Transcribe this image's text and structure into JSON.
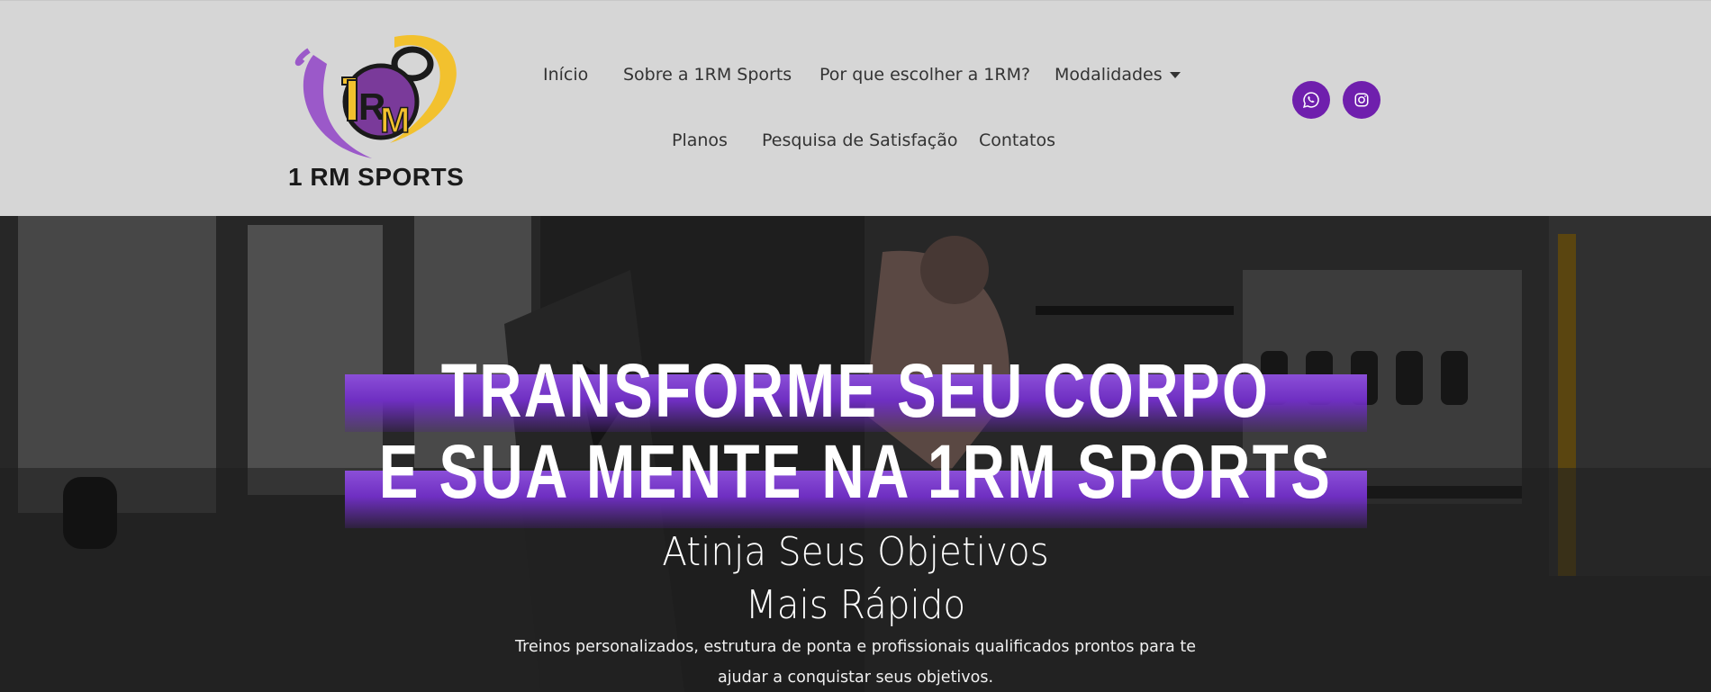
{
  "brand": {
    "logo_text": "1 RM SPORTS",
    "logo_monogram": "1RM",
    "colors": {
      "purple": "#8e4fc0",
      "yellow": "#f2c12e",
      "dark": "#1a1a1a"
    }
  },
  "nav": {
    "row1": [
      "Início",
      "Sobre a 1RM Sports",
      "Por que escolher a 1RM?",
      "Modalidades"
    ],
    "row2": [
      "Planos",
      "Pesquisa de Satisfação",
      "Contatos"
    ]
  },
  "social": [
    {
      "icon": "whatsapp-icon",
      "color": "#6f1fad"
    },
    {
      "icon": "instagram-icon",
      "color": "#6f1fad"
    }
  ],
  "hero": {
    "headline_line1": "TRANSFORME SEU CORPO",
    "headline_line2": "E SUA MENTE NA 1RM SPORTS",
    "subheadline_line1": "Atinja Seus Objetivos",
    "subheadline_line2": "Mais Rápido",
    "description": "Treinos personalizados, estrutura de ponta e profissionais qualificados prontos para te ajudar a conquistar seus objetivos.",
    "band_color": "#7b3fcf"
  }
}
